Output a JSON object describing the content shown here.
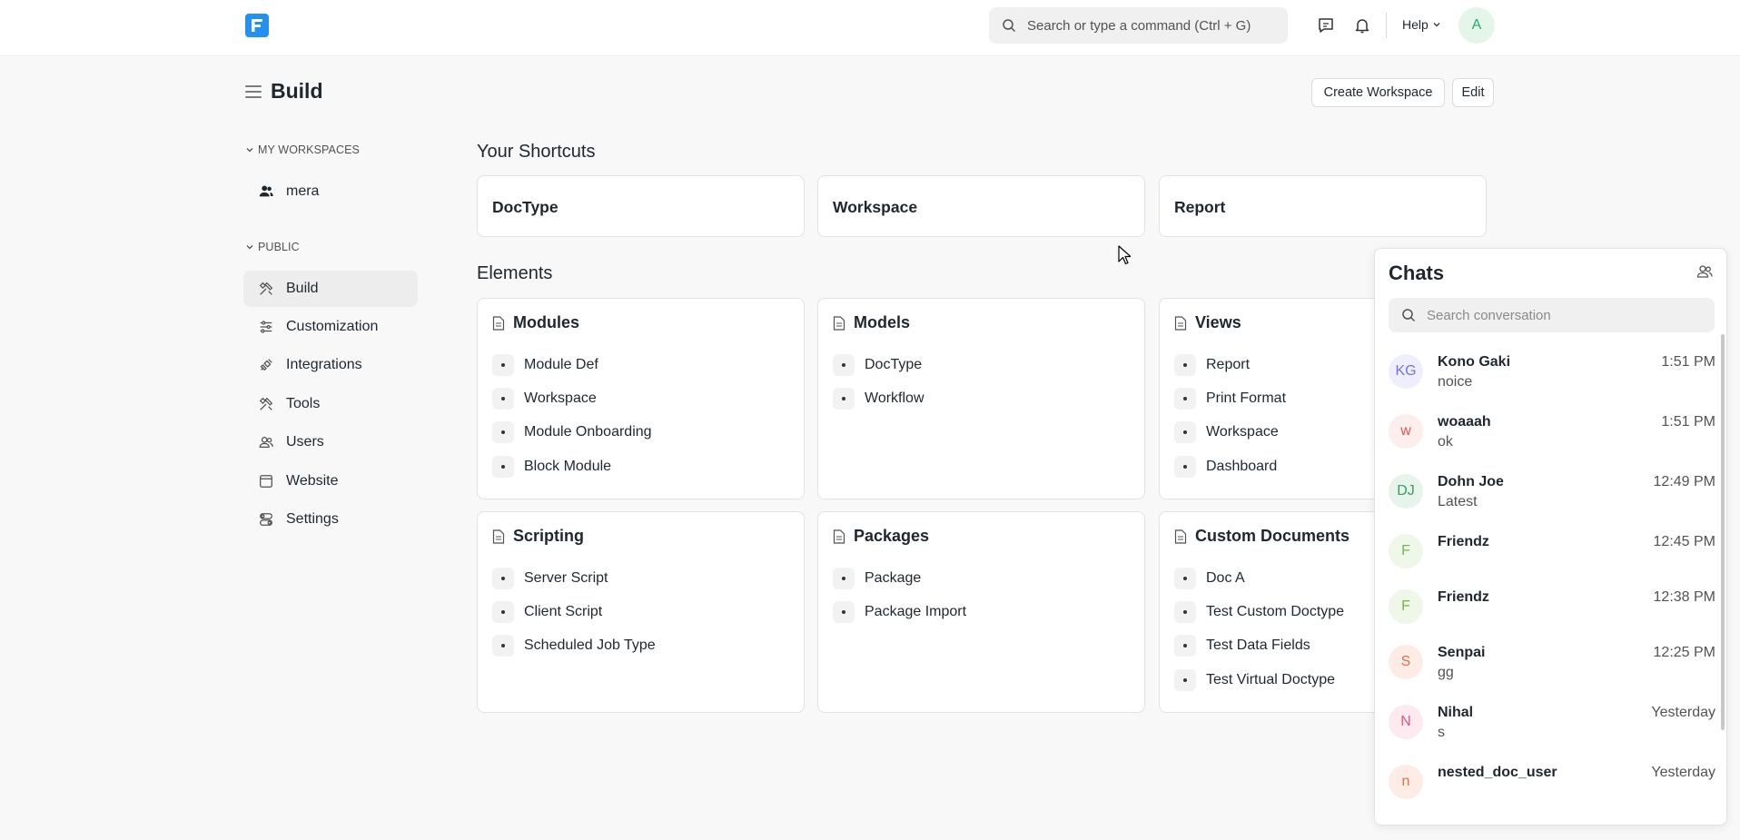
{
  "navbar": {
    "search_placeholder": "Search or type a command (Ctrl + G)",
    "help_label": "Help",
    "avatar_initial": "A"
  },
  "page": {
    "title": "Build",
    "create_workspace_label": "Create Workspace",
    "edit_label": "Edit"
  },
  "sidebar": {
    "my_workspaces_label": "MY WORKSPACES",
    "public_label": "PUBLIC",
    "my_items": [
      {
        "label": "mera",
        "icon": "users-icon"
      }
    ],
    "public_items": [
      {
        "label": "Build",
        "icon": "tools-icon",
        "active": true
      },
      {
        "label": "Customization",
        "icon": "sliders-icon"
      },
      {
        "label": "Integrations",
        "icon": "integration-icon"
      },
      {
        "label": "Tools",
        "icon": "tools-icon"
      },
      {
        "label": "Users",
        "icon": "users-icon"
      },
      {
        "label": "Website",
        "icon": "browser-icon"
      },
      {
        "label": "Settings",
        "icon": "settings-toggle-icon"
      }
    ]
  },
  "shortcuts": {
    "title": "Your Shortcuts",
    "items": [
      "DocType",
      "Workspace",
      "Report"
    ]
  },
  "elements": {
    "title": "Elements",
    "cards": [
      {
        "title": "Modules",
        "links": [
          "Module Def",
          "Workspace",
          "Module Onboarding",
          "Block Module"
        ]
      },
      {
        "title": "Models",
        "links": [
          "DocType",
          "Workflow"
        ]
      },
      {
        "title": "Views",
        "links": [
          "Report",
          "Print Format",
          "Workspace",
          "Dashboard"
        ]
      },
      {
        "title": "Scripting",
        "links": [
          "Server Script",
          "Client Script",
          "Scheduled Job Type"
        ]
      },
      {
        "title": "Packages",
        "links": [
          "Package",
          "Package Import"
        ]
      },
      {
        "title": "Custom Documents",
        "links": [
          "Doc A",
          "Test Custom Doctype",
          "Test Data Fields",
          "Test Virtual Doctype"
        ]
      }
    ]
  },
  "chats": {
    "title": "Chats",
    "search_placeholder": "Search conversation",
    "items": [
      {
        "initials": "KG",
        "name": "Kono Gaki",
        "time": "1:51 PM",
        "message": "noice",
        "bg": "#eeeefc",
        "fg": "#7575d6"
      },
      {
        "initials": "w",
        "name": "woaaah",
        "time": "1:51 PM",
        "message": "ok",
        "bg": "#fdeeee",
        "fg": "#e05757"
      },
      {
        "initials": "DJ",
        "name": "Dohn Joe",
        "time": "12:49 PM",
        "message": "Latest",
        "bg": "#e6f4ec",
        "fg": "#3b9b66"
      },
      {
        "initials": "F",
        "name": "Friendz",
        "time": "12:45 PM",
        "message": "",
        "bg": "#eef7e8",
        "fg": "#76b54a"
      },
      {
        "initials": "F",
        "name": "Friendz",
        "time": "12:38 PM",
        "message": "",
        "bg": "#eef7e8",
        "fg": "#76b54a"
      },
      {
        "initials": "S",
        "name": "Senpai",
        "time": "12:25 PM",
        "message": "gg",
        "bg": "#fdece6",
        "fg": "#e0704a"
      },
      {
        "initials": "N",
        "name": "Nihal",
        "time": "Yesterday",
        "message": "s",
        "bg": "#fdeaf0",
        "fg": "#e0557c"
      },
      {
        "initials": "n",
        "name": "nested_doc_user",
        "time": "Yesterday",
        "message": "",
        "bg": "#fdece6",
        "fg": "#e0704a"
      }
    ]
  }
}
